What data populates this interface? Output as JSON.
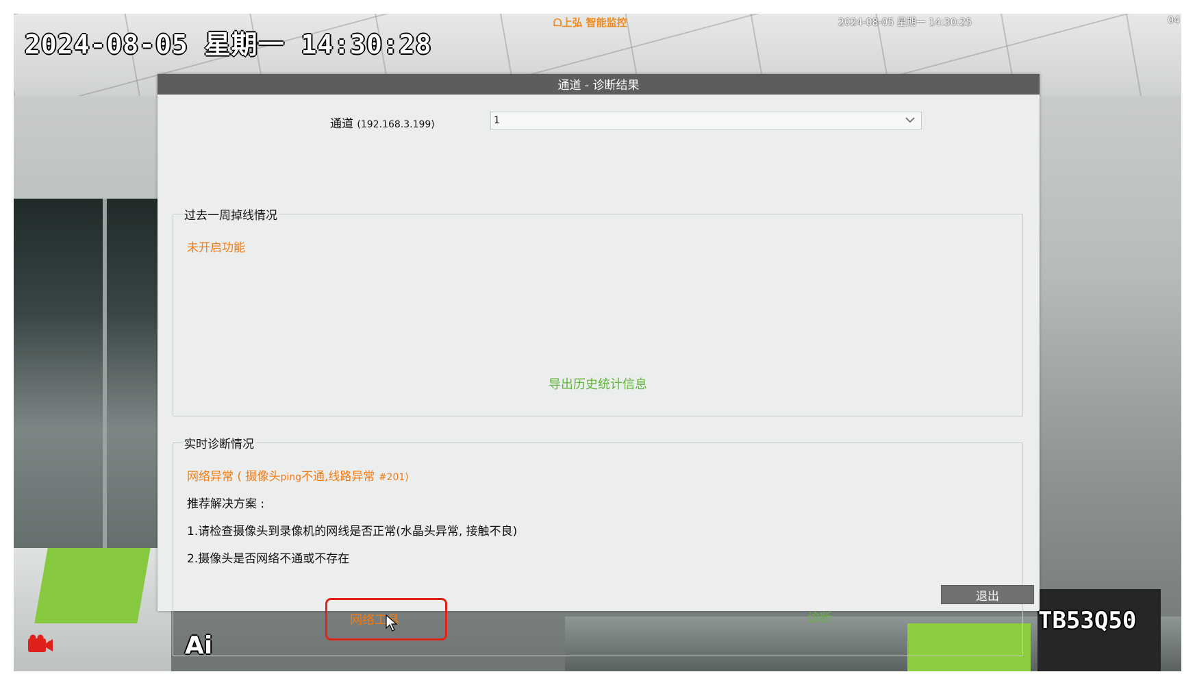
{
  "osd": {
    "datetime_large": "2024-08-05 星期一 14:30:28",
    "brand_logo": "ᗝ上弘 智能监控",
    "datetime_small": "2024-08-05 星期一 14:30:25",
    "channel_number": "04",
    "camera_name": "TB53Q50",
    "ai_label": "Ai",
    "record_icon_color": "#e0201a"
  },
  "dialog": {
    "title": "通道 - 诊断结果",
    "channel_label": "通道",
    "channel_ip": "(192.168.3.199)",
    "channel_value": "1",
    "weekly_group": {
      "legend": "过去一周掉线情况",
      "status": "未开启功能",
      "export_link": "导出历史统计信息"
    },
    "realtime_group": {
      "legend": "实时诊断情况",
      "error_prefix": "网络异常 ( 摄像头",
      "error_ping": "ping",
      "error_suffix": "不通,线路异常",
      "error_code": "#201)",
      "solution_title": "推荐解决方案 :",
      "solution_1": "1.请检查摄像头到录像机的网线是否正常(水晶头异常, 接触不良)",
      "solution_2": "2.摄像头是否网络不通或不存在",
      "network_tool_button": "网络工具",
      "diagnose_button": "诊断"
    },
    "exit_button": "退出"
  },
  "colors": {
    "accent_orange": "#f07c15",
    "accent_green": "#5fb53a",
    "highlight_red": "#e2231a",
    "title_bar": "#5b5d5e"
  }
}
